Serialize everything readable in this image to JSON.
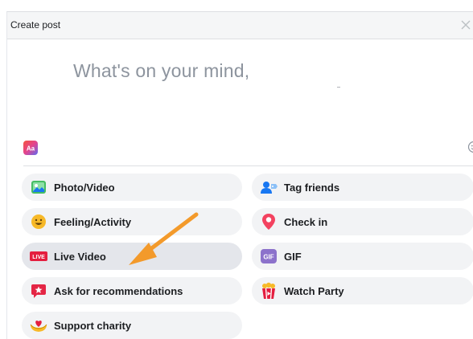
{
  "dialog": {
    "title": "Create post",
    "close_icon": "close-icon"
  },
  "composer": {
    "placeholder": "What's on your mind,"
  },
  "toolbar": {
    "background_icon": "text-background-icon",
    "emoji_icon": "emoji-icon"
  },
  "options": {
    "left": [
      {
        "label": "Photo/Video",
        "icon": "photo-video-icon"
      },
      {
        "label": "Feeling/Activity",
        "icon": "feeling-icon"
      },
      {
        "label": "Live Video",
        "icon": "live-video-icon",
        "badge": "LIVE"
      },
      {
        "label": "Ask for recommendations",
        "icon": "recommendations-icon"
      },
      {
        "label": "Support charity",
        "icon": "charity-icon"
      }
    ],
    "right": [
      {
        "label": "Tag friends",
        "icon": "tag-friends-icon"
      },
      {
        "label": "Check in",
        "icon": "check-in-icon"
      },
      {
        "label": "GIF",
        "icon": "gif-icon",
        "badge": "GIF"
      },
      {
        "label": "Watch Party",
        "icon": "watch-party-icon"
      }
    ]
  },
  "colors": {
    "arrow": "#f39a2b",
    "live_red": "#e41e3f",
    "gif_purple": "#8c72cb",
    "checkin_red": "#f3425f"
  }
}
